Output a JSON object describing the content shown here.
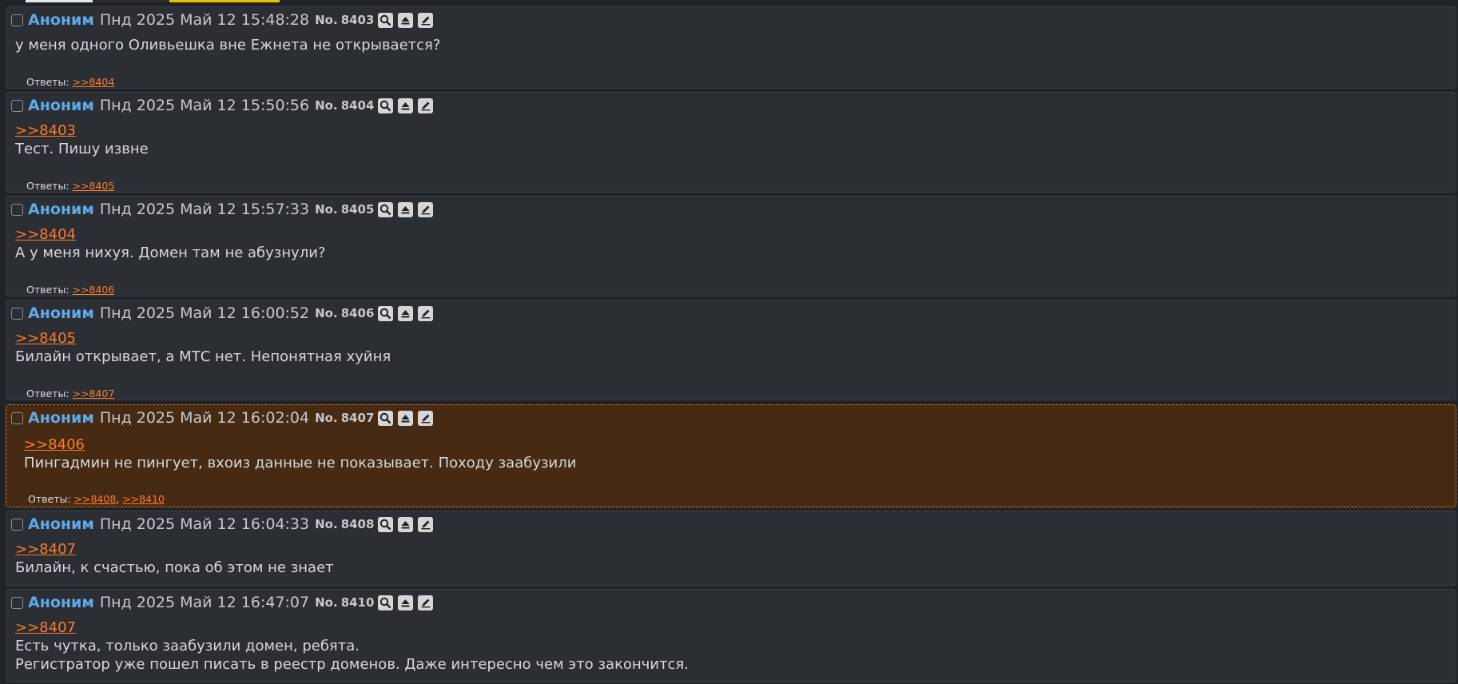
{
  "icons": [
    "magnifier-icon",
    "eject-icon",
    "pencil-icon"
  ],
  "colors": {
    "name": "#5fa9e8",
    "link": "#ff7a29",
    "post_bg": "#2b2e33",
    "highlight_bg": "#472a14",
    "highlight_border": "#e06a1b"
  },
  "posts": [
    {
      "name": "Аноним",
      "date": "Пнд 2025 Май 12 15:48:28",
      "num_label": "No.",
      "num": "8403",
      "quote": "",
      "lines": [
        "у меня одного Оливьешка вне Ежнета не открывается?",
        ""
      ],
      "replies_label": "Ответы:",
      "replies": [
        ">>8404"
      ]
    },
    {
      "name": "Аноним",
      "date": "Пнд 2025 Май 12 15:50:56",
      "num_label": "No.",
      "num": "8404",
      "quote": ">>8403",
      "lines": [
        "Тест. Пишу извне",
        ""
      ],
      "replies_label": "Ответы:",
      "replies": [
        ">>8405"
      ]
    },
    {
      "name": "Аноним",
      "date": "Пнд 2025 Май 12 15:57:33",
      "num_label": "No.",
      "num": "8405",
      "quote": ">>8404",
      "lines": [
        "А у меня нихуя. Домен там не абузнули?",
        ""
      ],
      "replies_label": "Ответы:",
      "replies": [
        ">>8406"
      ]
    },
    {
      "name": "Аноним",
      "date": "Пнд 2025 Май 12 16:00:52",
      "num_label": "No.",
      "num": "8406",
      "quote": ">>8405",
      "lines": [
        "Билайн открывает, а МТС нет. Непонятная хуйня",
        ""
      ],
      "replies_label": "Ответы:",
      "replies": [
        ">>8407"
      ]
    },
    {
      "name": "Аноним",
      "date": "Пнд 2025 Май 12 16:02:04",
      "num_label": "No.",
      "num": "8407",
      "quote": ">>8406",
      "lines": [
        "Пингадмин не пингует, вхоиз данные не показывает. Походу заабузили",
        ""
      ],
      "replies_label": "Ответы:",
      "replies": [
        ">>8408",
        ">>8410"
      ],
      "highlighted": true
    },
    {
      "name": "Аноним",
      "date": "Пнд 2025 Май 12 16:04:33",
      "num_label": "No.",
      "num": "8408",
      "quote": ">>8407",
      "lines": [
        "Билайн, к счастью, пока об этом не знает",
        ""
      ],
      "replies_label": "",
      "replies": []
    },
    {
      "name": "Аноним",
      "date": "Пнд 2025 Май 12 16:47:07",
      "num_label": "No.",
      "num": "8410",
      "quote": ">>8407",
      "lines": [
        "Есть чутка, только заабузили домен, ребята.",
        "Регистратор уже пошел писать в реестр доменов. Даже интересно чем это закончится."
      ],
      "replies_label": "",
      "replies": []
    }
  ]
}
